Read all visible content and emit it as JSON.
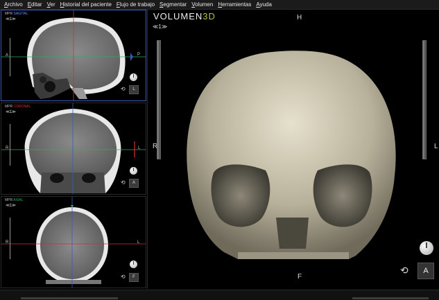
{
  "menu": [
    "Archivo",
    "Editar",
    "Ver",
    "Historial del paciente",
    "Flujo de trabajo",
    "Segmentar",
    "Volumen",
    "Herramientas",
    "Ayuda"
  ],
  "viewports": {
    "sagittal": {
      "mpr": "MPR",
      "plane": "SAGITAL",
      "nav": "≪1≫",
      "left": "A",
      "right": "P",
      "button": "L"
    },
    "coronal": {
      "mpr": "MPR",
      "plane": "CORONAL",
      "nav": "≪1≫",
      "left": "R",
      "right": "L",
      "button": "A"
    },
    "axial": {
      "mpr": "MPR",
      "plane": "AXIAL",
      "nav": "≪1≫",
      "left": "R",
      "right": "L",
      "button": "F"
    }
  },
  "volume3d": {
    "title_a": "VOLUMEN",
    "title_b": "3D",
    "nav": "≪1≫",
    "top": "H",
    "bottom": "F",
    "left": "R",
    "right": "L",
    "button": "A"
  },
  "colors": {
    "sagittal": "#6b8fff",
    "coronal": "#d03030",
    "axial": "#2faf62",
    "accent": "#b3c23a",
    "selected_border": "#3b5bb8"
  },
  "icons": {
    "rotate": "rotate-icon",
    "window_level": "window-level-icon",
    "nav": "slice-nav-icon"
  }
}
